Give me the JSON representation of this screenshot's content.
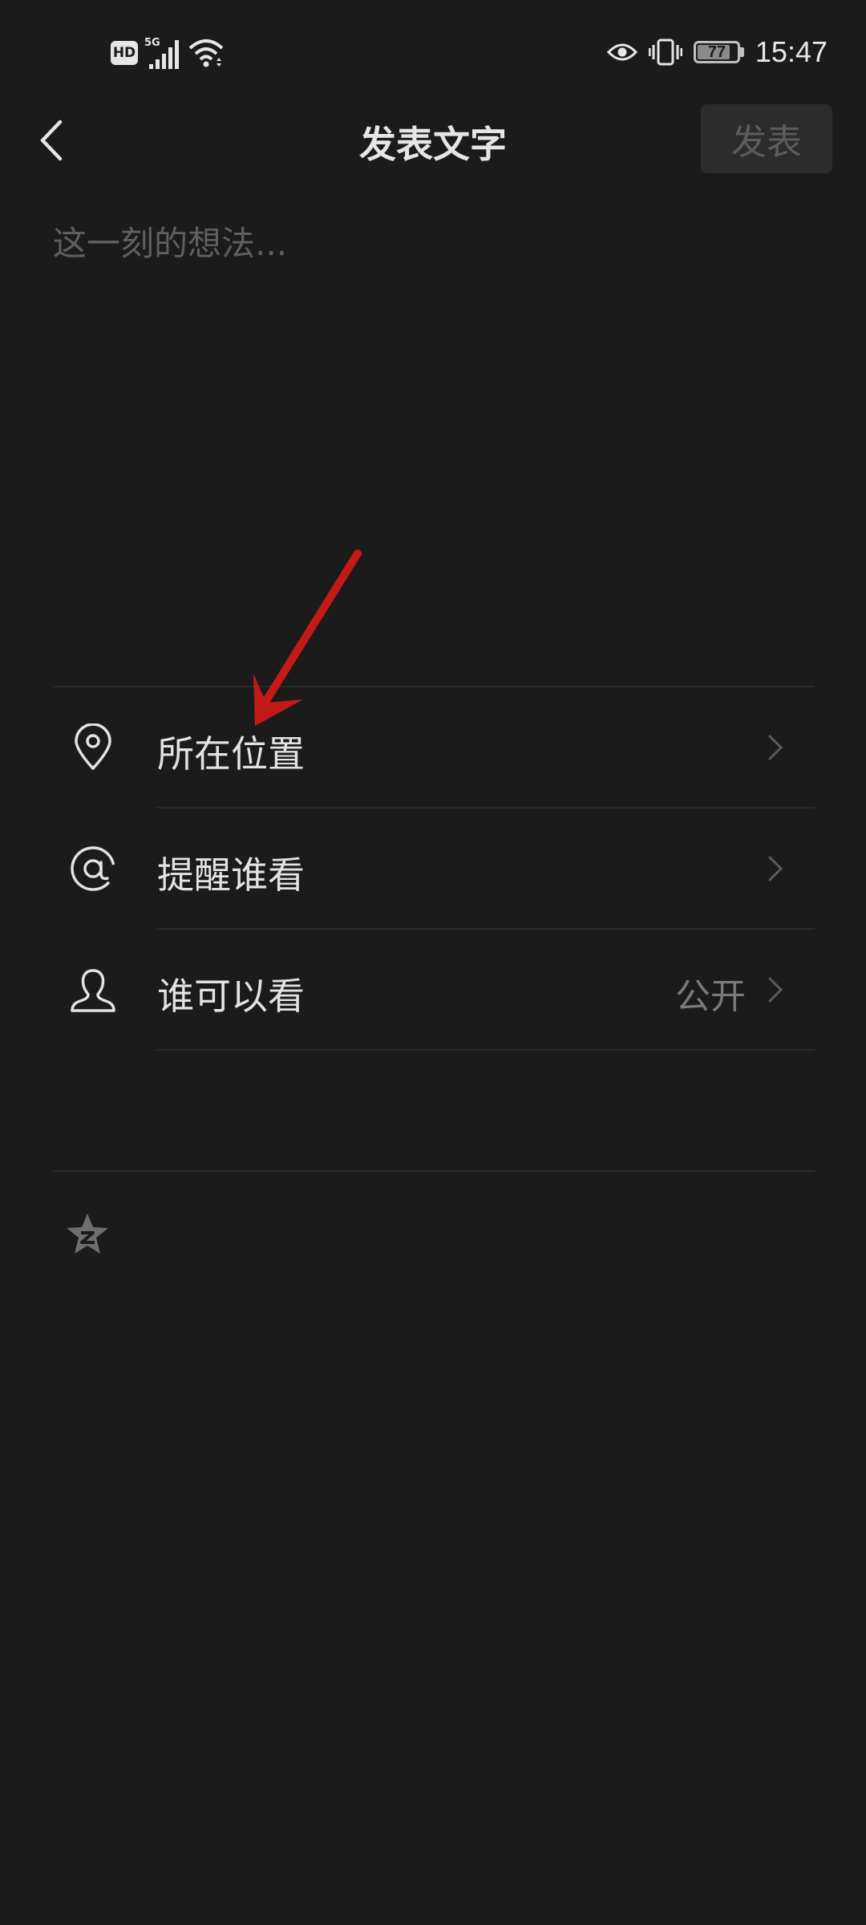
{
  "status_bar": {
    "hd": "HD",
    "network": "5G",
    "battery": "77",
    "time": "15:47"
  },
  "header": {
    "title": "发表文字",
    "publish_label": "发表"
  },
  "compose": {
    "placeholder": "这一刻的想法..."
  },
  "menu": {
    "location": "所在位置",
    "remind": "提醒谁看",
    "visibility": "谁可以看",
    "visibility_value": "公开"
  },
  "colors": {
    "background": "#1b1b1b",
    "annotation_arrow": "#c41a17"
  }
}
